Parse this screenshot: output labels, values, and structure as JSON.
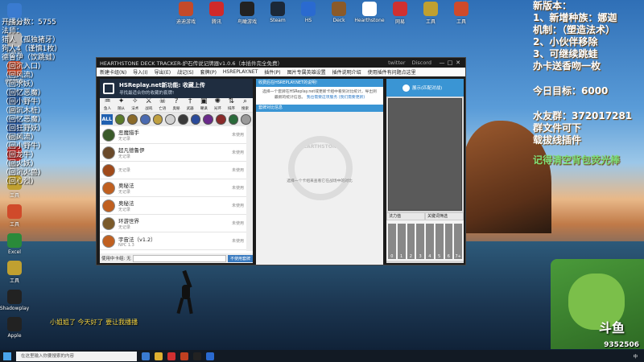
{
  "desktop": {
    "top_icons": [
      {
        "label": "迪迪游戏",
        "icon": "game-icon",
        "color": "#c44a2a"
      },
      {
        "label": "腾讯",
        "icon": "app-icon",
        "color": "#d02a2a"
      },
      {
        "label": "鸟瞰游戏",
        "icon": "app-icon",
        "color": "#222222"
      },
      {
        "label": "Steam",
        "icon": "steam-icon",
        "color": "#1b2838"
      },
      {
        "label": "HS",
        "icon": "hearthstone-icon",
        "color": "#2a6ad0"
      },
      {
        "label": "Deck",
        "icon": "deck-icon",
        "color": "#8a5a2a"
      },
      {
        "label": "Hearthstone",
        "icon": "hearthstone-icon",
        "color": "#ffffff"
      },
      {
        "label": "网易",
        "icon": "netease-icon",
        "color": "#d03030"
      },
      {
        "label": "工具",
        "icon": "tool-icon",
        "color": "#c0a030"
      },
      {
        "label": "工具",
        "icon": "tool-icon",
        "color": "#d04a2a"
      }
    ],
    "left_icons": [
      {
        "label": "此电脑",
        "icon": "computer-icon",
        "color": "#3a7bd0"
      },
      {
        "label": "回收站",
        "icon": "recycle-bin-icon",
        "color": "#b0b0b0"
      },
      {
        "label": "控制面板",
        "icon": "control-panel-icon",
        "color": "#d04a2a"
      },
      {
        "label": "游戏",
        "icon": "game-icon",
        "color": "#2a5a9a"
      },
      {
        "label": "Word",
        "icon": "word-icon",
        "color": "#2a5aa0"
      },
      {
        "label": "游戏",
        "icon": "game-icon",
        "color": "#c03030"
      },
      {
        "label": "工具",
        "icon": "tool-icon",
        "color": "#c0a030"
      },
      {
        "label": "工具",
        "icon": "tool-icon",
        "color": "#d04a2a"
      },
      {
        "label": "Excel",
        "icon": "excel-icon",
        "color": "#2a8a3a"
      },
      {
        "label": "工具",
        "icon": "tool-icon",
        "color": "#c0a030"
      },
      {
        "label": "Shadowplay",
        "icon": "video-icon",
        "color": "#222222"
      },
      {
        "label": "Apple",
        "icon": "app-icon",
        "color": "#222222"
      }
    ]
  },
  "left_overlay": {
    "score": "开播分数：5755",
    "lines": [
      "法师：",
      "猎人（孤独猪牙）",
      "狗人4（谨慎1枚）",
      "德鲁伊（饮跳蛙）",
      "（回沉入口）",
      "（回风流）",
      "（回水妖）",
      "（回忆恶魔）",
      "（回小野牛）",
      "（回沉木桩）",
      "（回忆恶魔）",
      "（回狂野妖）",
      "（回风流）",
      "（回小野牛）",
      "（回龙牛）",
      "（回火妖）",
      "（回沉火兽）",
      "（回心烈）"
    ]
  },
  "right_overlay": {
    "title": "新版本：",
    "l1": "1、新增种族：娜迦",
    "l2": "机制：（塑造法术）",
    "l3": "2、小伙伴移除",
    "l4": "3、可继续跳蛙",
    "l5": "办卡送香吻一枚",
    "goal": "今日目标：6000",
    "group_label": "水友群：372017281",
    "group_note1": "群文件可下",
    "group_note2": "载拔线插件",
    "reminder": "记得清空背包荧光棒"
  },
  "bottom_overlay": "小姐姐了 今天好了 要让我播播",
  "streamer": {
    "logo": "斗鱼",
    "room": "9352506"
  },
  "app": {
    "title": "HEARTHSTONE DECK TRACKER-炉石传说记牌器v1.0.6（本插件完全免费）",
    "title_btns": [
      "twitter",
      "Discord"
    ],
    "menu": [
      "新建卡组(N)",
      "导入(I)",
      "导出(E)",
      "战记(S)",
      "套牌(P)",
      "HSREPLAY.NET",
      "插件(P)",
      "图片专属英雄设置",
      "插件说明介绍",
      "使用插件有问题点这里"
    ],
    "banner": {
      "title": "HSReplay.net新功能: 收藏上传",
      "subtitle": "寻找最适合你的收藏的套牌!"
    },
    "class_filters": [
      "鱼人",
      "随从",
      "法术",
      "战吼",
      "亡语",
      "奥秘",
      "武器",
      "嘲讽",
      "光环",
      "排序",
      "搜索"
    ],
    "class_portraits": [
      "ALL",
      "德鲁伊",
      "猎人",
      "法师",
      "圣骑士",
      "牧师",
      "潜行者",
      "萨满",
      "术士",
      "战士",
      "恶魔猎手",
      "中立"
    ],
    "decks": [
      {
        "name": "恶魔猎手",
        "sub": "无记录",
        "status": "未使用",
        "color": "#3a5a2a"
      },
      {
        "name": "超凡德鲁伊",
        "sub": "无记录",
        "status": "未使用",
        "color": "#6a4a2a"
      },
      {
        "name": "",
        "sub": "无记录",
        "status": "未使用",
        "color": "#a04a1a"
      },
      {
        "name": "奥秘法",
        "sub": "无记录",
        "status": "未使用",
        "color": "#c06020"
      },
      {
        "name": "奥秘法",
        "sub": "无记录",
        "status": "未使用",
        "color": "#c06020"
      },
      {
        "name": "环游世界",
        "sub": "无记录",
        "status": "未使用",
        "color": "#7a5a2a"
      },
      {
        "name": "宇宙法（v1.2）",
        "sub": "NPC 1.3",
        "status": "未使用",
        "color": "#c06020"
      }
    ],
    "search_label": "使用中卡组: 无",
    "search_btn": "不使用套牌",
    "mid_header": "收费后在HSREPLAY.NET的说明!",
    "mid_text": "选择一个套牌在HSReplay.net或更新卡组中看到对比统计，导出到最新的统计信息。",
    "mid_link": "我也需要这项服务 (我们需要更新)",
    "mid_header2": "套牌对比信息",
    "mid_watermark": "HEARTHSTONE",
    "mid_hint": "选择一个卡组来查看它在战场中的对比",
    "right_top": "展示(匹配对战)",
    "right_tabs": [
      "法力值",
      "关键词筛选"
    ],
    "mana_cols": [
      "0",
      "1",
      "2",
      "3",
      "4",
      "5",
      "6",
      "7+"
    ]
  },
  "taskbar": {
    "search_placeholder": "在这里输入你要搜索的内容",
    "time": "中"
  }
}
